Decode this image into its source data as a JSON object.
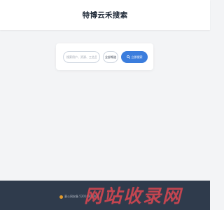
{
  "header": {
    "title": "特博云禾搜索"
  },
  "search": {
    "placeholder": "搜索用户、资源、工艺品",
    "filter_label": "全部频道",
    "button_label": "立即搜索"
  },
  "footer": {
    "text": "意公网安备 52010302000..."
  },
  "watermark": {
    "text": "网站收录网"
  },
  "colors": {
    "accent": "#3b7ddd",
    "footer_bg": "#2f3b4c",
    "page_bg": "#f3f4f6"
  }
}
